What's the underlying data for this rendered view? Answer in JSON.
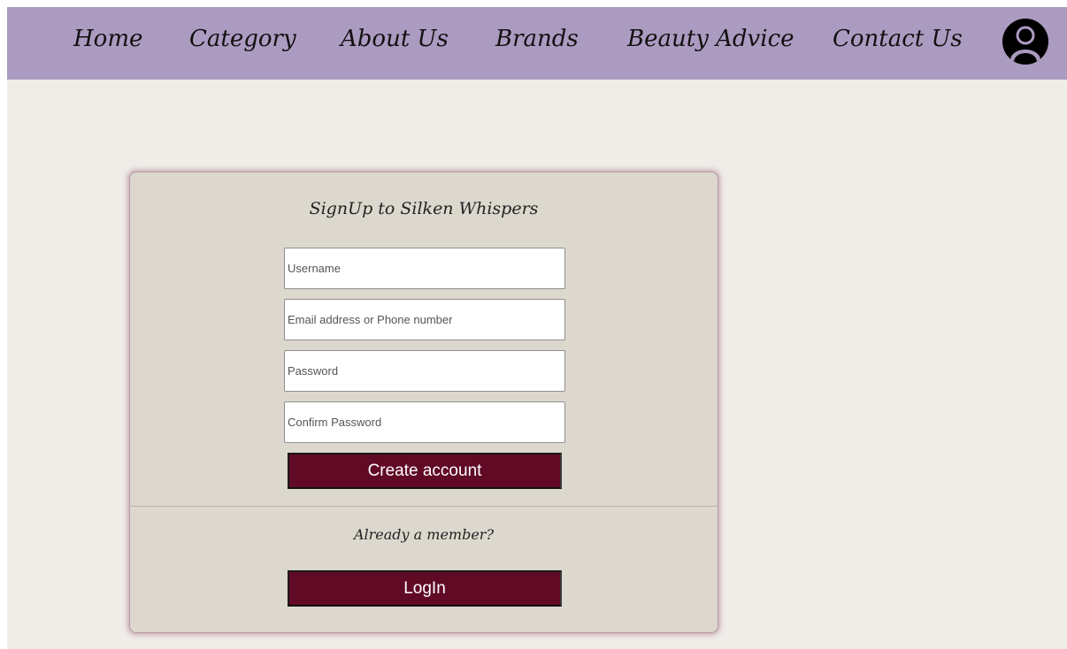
{
  "nav": {
    "items": [
      {
        "label": "Home"
      },
      {
        "label": "Category"
      },
      {
        "label": "About Us"
      },
      {
        "label": "Brands"
      },
      {
        "label": "Beauty Advice"
      },
      {
        "label": "Contact Us"
      }
    ],
    "account_icon": "user-circle-icon"
  },
  "signup": {
    "title": "SignUp to Silken Whispers",
    "username_placeholder": "Username",
    "email_placeholder": "Email address or Phone number",
    "password_placeholder": "Password",
    "confirm_password_placeholder": "Confirm Password",
    "create_label": "Create account",
    "member_text": "Already a member?",
    "login_label": "LogIn"
  },
  "colors": {
    "navbar": "#ac9bc1",
    "page_background": "#f0ece8",
    "card_background": "#ddd8ce",
    "button": "#610a25"
  }
}
